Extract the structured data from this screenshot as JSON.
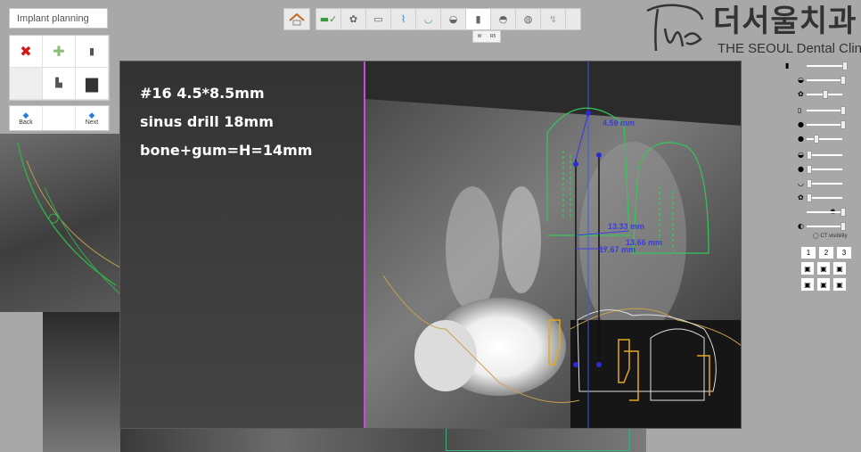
{
  "panel_title": "Implant planning",
  "nav": {
    "back": "Back",
    "next": "Next"
  },
  "sub_tip": {
    "a": "W",
    "b": "R5"
  },
  "logo": {
    "korean": "더서울치과",
    "english": "THE SEOUL Dental Clinic",
    "mark": "The"
  },
  "annotation": {
    "line1": "#16 4.5*8.5mm",
    "line2": "sinus drill 18mm",
    "line3": "bone+gum=H=14mm"
  },
  "measurements": {
    "m1": "4.59 mm",
    "m2": "13.33 mm",
    "m3": "17.67 mm",
    "m4": "13.66 mm"
  },
  "ct_visibility_label": "CT visibility",
  "number_buttons": [
    "1",
    "2",
    "3"
  ],
  "colors": {
    "accent_blue": "#2a7ed6",
    "implant_green": "#34c759",
    "tooth_outline": "#e0e0e0",
    "crown_yellow": "#e3a820",
    "axis_magenta": "#c84cd6",
    "axis_blue": "#3b5be0"
  }
}
